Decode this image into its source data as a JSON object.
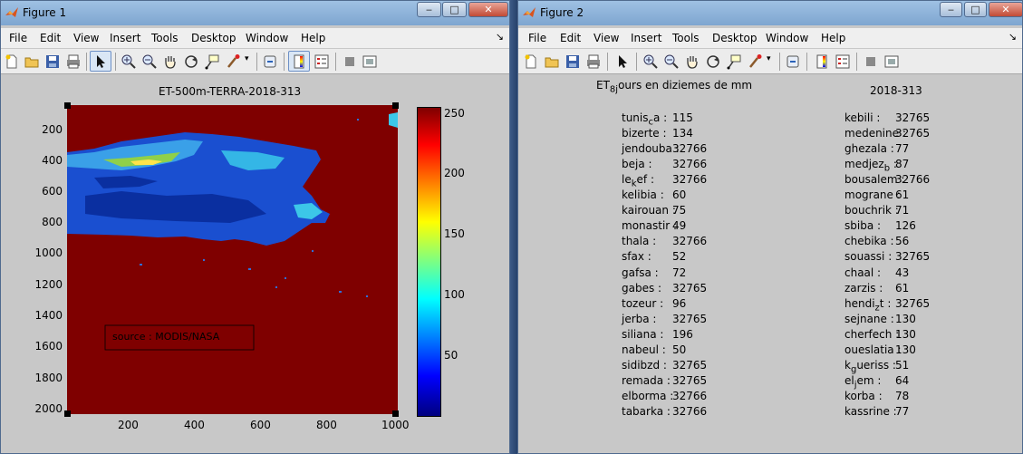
{
  "fig1": {
    "title": "Figure 1",
    "buttons": {
      "minimize": "‒",
      "maximize": "□",
      "close": "✕"
    },
    "menu": [
      "File",
      "Edit",
      "View",
      "Insert",
      "Tools",
      "Desktop",
      "Window",
      "Help"
    ],
    "dock": "↘",
    "plot": {
      "title": "ET-500m-TERRA-2018-313",
      "yticks": [
        "200",
        "400",
        "600",
        "800",
        "1000",
        "1200",
        "1400",
        "1600",
        "1800",
        "2000"
      ],
      "xticks": [
        "200",
        "400",
        "600",
        "800",
        "1000"
      ],
      "annotation": "source : MODIS/NASA",
      "colorbar_ticks": [
        "250",
        "200",
        "150",
        "100",
        "50"
      ],
      "colors": {
        "background": "#7f0000",
        "land_scale": [
          "#00007f",
          "#0000ff",
          "#00ffff",
          "#ffff00",
          "#ff0000",
          "#7f0000"
        ]
      }
    }
  },
  "fig2": {
    "title": "Figure 2",
    "buttons": {
      "minimize": "‒",
      "maximize": "□",
      "close": "✕"
    },
    "menu": [
      "File",
      "Edit",
      "View",
      "Insert",
      "Tools",
      "Desktop",
      "Window",
      "Help"
    ],
    "dock": "↘",
    "heading_left": "ET",
    "heading_left_sub": "8j",
    "heading_left_rest": "ours en diziemes de mm",
    "heading_right": "2018-313",
    "left_col": [
      {
        "name": "tunis",
        "sub": "c",
        "rest": "a :",
        "value": "115"
      },
      {
        "name": "bizerte :",
        "value": "134"
      },
      {
        "name": "jendouba :",
        "value": "32766"
      },
      {
        "name": "beja :",
        "value": "32766"
      },
      {
        "name": "le",
        "sub": "k",
        "rest": "ef :",
        "value": "32766"
      },
      {
        "name": "kelibia :",
        "value": "60"
      },
      {
        "name": "kairouan :",
        "value": "75"
      },
      {
        "name": "monastir :",
        "value": "49"
      },
      {
        "name": "thala :",
        "value": "32766"
      },
      {
        "name": "sfax :",
        "value": "52"
      },
      {
        "name": "gafsa :",
        "value": "72"
      },
      {
        "name": "gabes :",
        "value": "32765"
      },
      {
        "name": "tozeur :",
        "value": "96"
      },
      {
        "name": "jerba :",
        "value": "32765"
      },
      {
        "name": "siliana :",
        "value": "196"
      },
      {
        "name": "nabeul :",
        "value": "50"
      },
      {
        "name": "sidibzd :",
        "value": "32765"
      },
      {
        "name": "remada :",
        "value": "32765"
      },
      {
        "name": "elborma :",
        "value": "32766"
      },
      {
        "name": "tabarka :",
        "value": "32766"
      }
    ],
    "right_col": [
      {
        "name": "kebili :",
        "value": "32765"
      },
      {
        "name": "medenine :",
        "value": "32765"
      },
      {
        "name": "ghezala :",
        "value": "77"
      },
      {
        "name": "medjez",
        "sub": "b",
        "rest": " :",
        "value": "87"
      },
      {
        "name": "bousalem :",
        "value": "32766"
      },
      {
        "name": "mograne :",
        "value": "61"
      },
      {
        "name": "bouchrik :",
        "value": "71"
      },
      {
        "name": "sbiba :",
        "value": "126"
      },
      {
        "name": "chebika :",
        "value": "56"
      },
      {
        "name": "souassi :",
        "value": "32765"
      },
      {
        "name": "chaal :",
        "value": "43"
      },
      {
        "name": "zarzis :",
        "value": "61"
      },
      {
        "name": "hendi",
        "sub": "z",
        "rest": "t :",
        "value": "32765"
      },
      {
        "name": "sejnane :",
        "value": "130"
      },
      {
        "name": "cherfech :",
        "value": "130"
      },
      {
        "name": "oueslatia :",
        "value": "130"
      },
      {
        "name": "k",
        "sub": "g",
        "rest": "ueriss :",
        "value": "51"
      },
      {
        "name": "el",
        "sub": "j",
        "rest": "em :",
        "value": "64"
      },
      {
        "name": "korba :",
        "value": "78"
      },
      {
        "name": "kassrine :",
        "value": "77"
      }
    ]
  }
}
